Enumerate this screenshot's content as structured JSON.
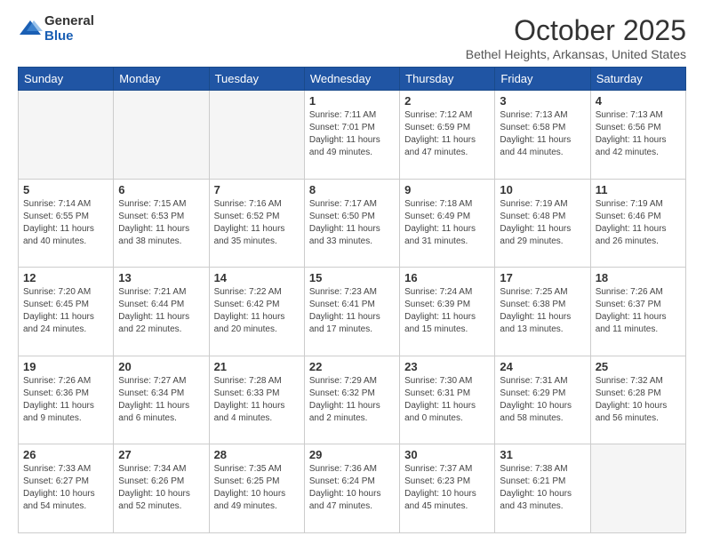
{
  "logo": {
    "general": "General",
    "blue": "Blue"
  },
  "title": "October 2025",
  "location": "Bethel Heights, Arkansas, United States",
  "days_of_week": [
    "Sunday",
    "Monday",
    "Tuesday",
    "Wednesday",
    "Thursday",
    "Friday",
    "Saturday"
  ],
  "weeks": [
    [
      {
        "day": "",
        "info": ""
      },
      {
        "day": "",
        "info": ""
      },
      {
        "day": "",
        "info": ""
      },
      {
        "day": "1",
        "info": "Sunrise: 7:11 AM\nSunset: 7:01 PM\nDaylight: 11 hours and 49 minutes."
      },
      {
        "day": "2",
        "info": "Sunrise: 7:12 AM\nSunset: 6:59 PM\nDaylight: 11 hours and 47 minutes."
      },
      {
        "day": "3",
        "info": "Sunrise: 7:13 AM\nSunset: 6:58 PM\nDaylight: 11 hours and 44 minutes."
      },
      {
        "day": "4",
        "info": "Sunrise: 7:13 AM\nSunset: 6:56 PM\nDaylight: 11 hours and 42 minutes."
      }
    ],
    [
      {
        "day": "5",
        "info": "Sunrise: 7:14 AM\nSunset: 6:55 PM\nDaylight: 11 hours and 40 minutes."
      },
      {
        "day": "6",
        "info": "Sunrise: 7:15 AM\nSunset: 6:53 PM\nDaylight: 11 hours and 38 minutes."
      },
      {
        "day": "7",
        "info": "Sunrise: 7:16 AM\nSunset: 6:52 PM\nDaylight: 11 hours and 35 minutes."
      },
      {
        "day": "8",
        "info": "Sunrise: 7:17 AM\nSunset: 6:50 PM\nDaylight: 11 hours and 33 minutes."
      },
      {
        "day": "9",
        "info": "Sunrise: 7:18 AM\nSunset: 6:49 PM\nDaylight: 11 hours and 31 minutes."
      },
      {
        "day": "10",
        "info": "Sunrise: 7:19 AM\nSunset: 6:48 PM\nDaylight: 11 hours and 29 minutes."
      },
      {
        "day": "11",
        "info": "Sunrise: 7:19 AM\nSunset: 6:46 PM\nDaylight: 11 hours and 26 minutes."
      }
    ],
    [
      {
        "day": "12",
        "info": "Sunrise: 7:20 AM\nSunset: 6:45 PM\nDaylight: 11 hours and 24 minutes."
      },
      {
        "day": "13",
        "info": "Sunrise: 7:21 AM\nSunset: 6:44 PM\nDaylight: 11 hours and 22 minutes."
      },
      {
        "day": "14",
        "info": "Sunrise: 7:22 AM\nSunset: 6:42 PM\nDaylight: 11 hours and 20 minutes."
      },
      {
        "day": "15",
        "info": "Sunrise: 7:23 AM\nSunset: 6:41 PM\nDaylight: 11 hours and 17 minutes."
      },
      {
        "day": "16",
        "info": "Sunrise: 7:24 AM\nSunset: 6:39 PM\nDaylight: 11 hours and 15 minutes."
      },
      {
        "day": "17",
        "info": "Sunrise: 7:25 AM\nSunset: 6:38 PM\nDaylight: 11 hours and 13 minutes."
      },
      {
        "day": "18",
        "info": "Sunrise: 7:26 AM\nSunset: 6:37 PM\nDaylight: 11 hours and 11 minutes."
      }
    ],
    [
      {
        "day": "19",
        "info": "Sunrise: 7:26 AM\nSunset: 6:36 PM\nDaylight: 11 hours and 9 minutes."
      },
      {
        "day": "20",
        "info": "Sunrise: 7:27 AM\nSunset: 6:34 PM\nDaylight: 11 hours and 6 minutes."
      },
      {
        "day": "21",
        "info": "Sunrise: 7:28 AM\nSunset: 6:33 PM\nDaylight: 11 hours and 4 minutes."
      },
      {
        "day": "22",
        "info": "Sunrise: 7:29 AM\nSunset: 6:32 PM\nDaylight: 11 hours and 2 minutes."
      },
      {
        "day": "23",
        "info": "Sunrise: 7:30 AM\nSunset: 6:31 PM\nDaylight: 11 hours and 0 minutes."
      },
      {
        "day": "24",
        "info": "Sunrise: 7:31 AM\nSunset: 6:29 PM\nDaylight: 10 hours and 58 minutes."
      },
      {
        "day": "25",
        "info": "Sunrise: 7:32 AM\nSunset: 6:28 PM\nDaylight: 10 hours and 56 minutes."
      }
    ],
    [
      {
        "day": "26",
        "info": "Sunrise: 7:33 AM\nSunset: 6:27 PM\nDaylight: 10 hours and 54 minutes."
      },
      {
        "day": "27",
        "info": "Sunrise: 7:34 AM\nSunset: 6:26 PM\nDaylight: 10 hours and 52 minutes."
      },
      {
        "day": "28",
        "info": "Sunrise: 7:35 AM\nSunset: 6:25 PM\nDaylight: 10 hours and 49 minutes."
      },
      {
        "day": "29",
        "info": "Sunrise: 7:36 AM\nSunset: 6:24 PM\nDaylight: 10 hours and 47 minutes."
      },
      {
        "day": "30",
        "info": "Sunrise: 7:37 AM\nSunset: 6:23 PM\nDaylight: 10 hours and 45 minutes."
      },
      {
        "day": "31",
        "info": "Sunrise: 7:38 AM\nSunset: 6:21 PM\nDaylight: 10 hours and 43 minutes."
      },
      {
        "day": "",
        "info": ""
      }
    ]
  ]
}
